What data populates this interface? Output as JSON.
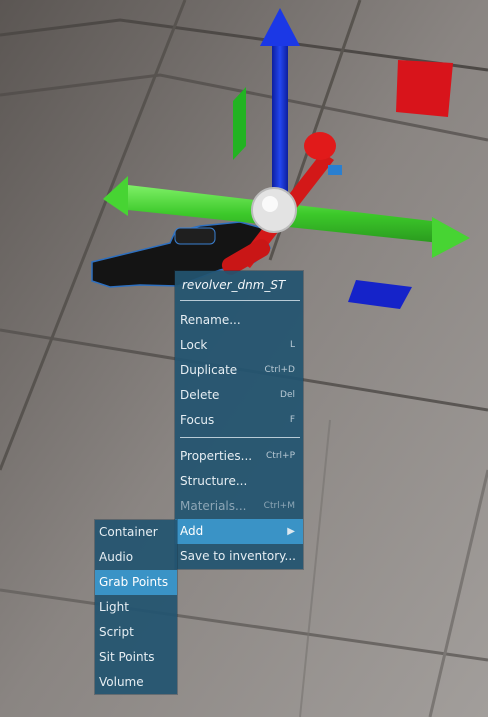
{
  "context_menu": {
    "title": "revolver_dnm_ST",
    "items": [
      {
        "label": "Rename...",
        "shortcut": ""
      },
      {
        "label": "Lock",
        "shortcut": "L"
      },
      {
        "label": "Duplicate",
        "shortcut": "Ctrl+D"
      },
      {
        "label": "Delete",
        "shortcut": "Del"
      },
      {
        "label": "Focus",
        "shortcut": "F"
      },
      {
        "label": "Properties...",
        "shortcut": "Ctrl+P"
      },
      {
        "label": "Structure...",
        "shortcut": ""
      },
      {
        "label": "Materials...",
        "shortcut": "Ctrl+M",
        "disabled": true
      },
      {
        "label": "Add",
        "shortcut": "",
        "has_submenu": true,
        "highlighted": true
      },
      {
        "label": "Save to inventory...",
        "shortcut": ""
      }
    ],
    "submenu_arrow": "▶"
  },
  "add_submenu": {
    "items": [
      {
        "label": "Container"
      },
      {
        "label": "Audio"
      },
      {
        "label": "Grab Points",
        "highlighted": true
      },
      {
        "label": "Light"
      },
      {
        "label": "Script"
      },
      {
        "label": "Sit Points"
      },
      {
        "label": "Volume"
      }
    ]
  },
  "scene": {
    "object": "revolver-model",
    "gizmo_colors": {
      "x_axis": "#3bd42a",
      "y_axis": "#d41818",
      "z_axis": "#1730d8"
    }
  }
}
